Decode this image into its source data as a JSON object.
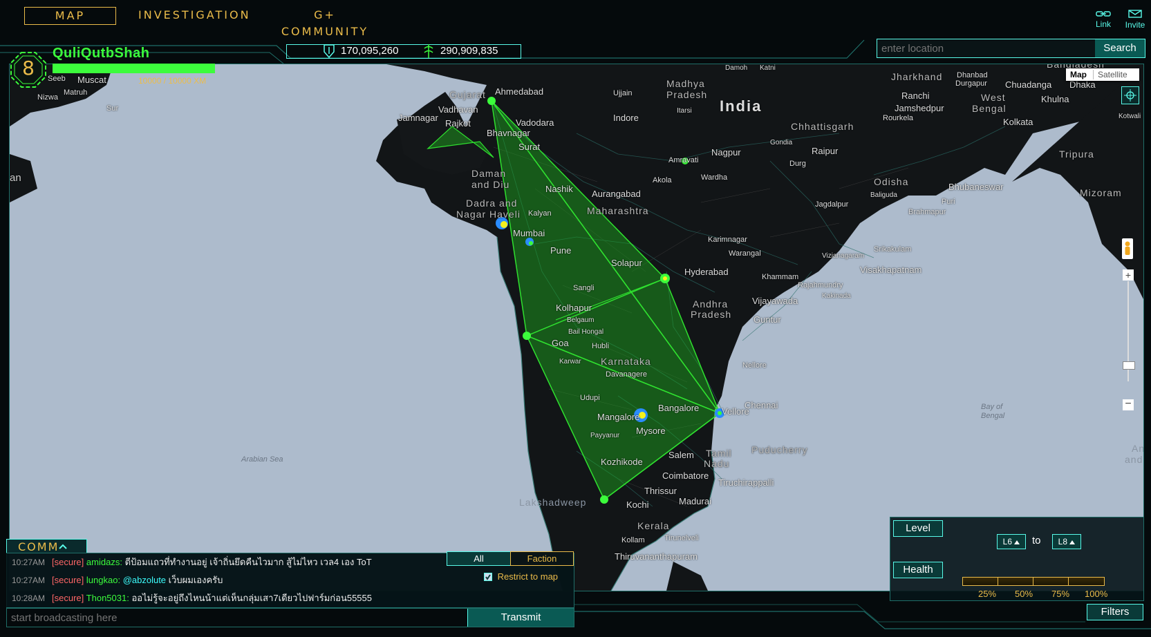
{
  "nav": {
    "tabs": [
      {
        "label": "MAP",
        "active": true
      },
      {
        "label": "INVESTIGATION",
        "active": false
      },
      {
        "label": "G+ COMMUNITY",
        "active": false
      }
    ],
    "link_label": "Link",
    "invite_label": "Invite"
  },
  "player": {
    "level": "8",
    "name": "QuliQutbShah",
    "xm": "10000 / 10000 XM",
    "xm_fraction": 1.0
  },
  "score": {
    "enlightened": "170,095,260",
    "resistance": "290,909,835"
  },
  "search": {
    "placeholder": "enter location",
    "button": "Search"
  },
  "map_controls": {
    "map": "Map",
    "satellite": "Satellite"
  },
  "labels": {
    "muscat": "Muscat",
    "seeb": "Seeb",
    "matruh": "Matruh",
    "nizwa": "Nizwa",
    "sur": "Sur",
    "iran": "an",
    "gujarat": "Gujarat",
    "ahmedabad": "Ahmedabad",
    "vadodara": "Vadodara",
    "vadhavan": "Vadhavan",
    "rajkot": "Rajkot",
    "jamnagar": "Jamnagar",
    "bhavnagar": "Bhavnagar",
    "surat": "Surat",
    "daman": "Daman",
    "and_diu": "and Diu",
    "dadra": "Dadra and",
    "nagar": "Nagar Haveli",
    "nashik": "Nashik",
    "aurangabad": "Aurangabad",
    "maharashtra": "Maharashtra",
    "kalyan": "Kalyan",
    "mumbai": "Mumbai",
    "pune": "Pune",
    "solapur": "Solapur",
    "sangli": "Sangli",
    "kolhapur": "Kolhapur",
    "belgaum": "Belgaum",
    "bail": "Bail Hongal",
    "hubli": "Hubli",
    "goa": "Goa",
    "karwar": "Karwar",
    "karnataka": "Karnataka",
    "davanagere": "Davanagere",
    "udupi": "Udupi",
    "mangalore": "Mangalore",
    "mysore": "Mysore",
    "bangalore": "Bangalore",
    "payyanur": "Payyanur",
    "kozhikode": "Kozhikode",
    "thrissur": "Thrissur",
    "kochi": "Kochi",
    "kerala": "Kerala",
    "kollam": "Kollam",
    "tvm": "Thiruvananthapuram",
    "madurai": "Madurai",
    "tirunelveli": "Tirunelveli",
    "salem": "Salem",
    "tamil": "Tamil",
    "nadu": "Nadu",
    "coimbatore": "Coimbatore",
    "tiruchirappalli": "Tiruchirappalli",
    "vellore": "Vellore",
    "chennai": "Chennai",
    "puducherry": "Puducherry",
    "nellore": "Nellore",
    "hyderabad": "Hyderabad",
    "andhra": "Andhra",
    "pradesh": "Pradesh",
    "guntur": "Guntur",
    "vijayawada": "Vijayawada",
    "khammam": "Khammam",
    "warangal": "Warangal",
    "karimnagar": "Karimnagar",
    "rajahmundry": "Rajahmundry",
    "kakinada": "Kakinada",
    "visakhapatnam": "Visakhapatnam",
    "srikakulam": "Srikakulam",
    "vizianagaram": "Vizianagaram",
    "india": "India",
    "madhya": "Madhya",
    "pradesh2": "Pradesh",
    "ujjain": "Ujjain",
    "indore": "Indore",
    "itarsi": "Itarsi",
    "damoh": "Damoh",
    "katni": "Katni",
    "nagpur": "Nagpur",
    "amravati": "Amravati",
    "wardha": "Wardha",
    "akola": "Akola",
    "gondia": "Gondia",
    "durg": "Durg",
    "raipur": "Raipur",
    "chhattisgarh": "Chhattisgarh",
    "jagdalpur": "Jagdalpur",
    "odisha": "Odisha",
    "baliguda": "Baliguda",
    "brahmapur": "Brahmapur",
    "bhubaneswar": "Bhubaneswar",
    "puri": "Puri",
    "rourkela": "Rourkela",
    "jharkhand": "Jharkhand",
    "dhanbad": "Dhanbad",
    "ranchi": "Ranchi",
    "durgapur": "Durgapur",
    "jamshedpur": "Jamshedpur",
    "west": "West",
    "bengal": "Bengal",
    "kolkata": "Kolkata",
    "chuadanga": "Chuadanga",
    "khulna": "Khulna",
    "dhaka": "Dhaka",
    "bangladesh": "Bangladesh",
    "tripura": "Tripura",
    "mizoram": "Mizoram",
    "kotwali": "Kotwali",
    "bay": "Bay of",
    "bay2": "Bengal",
    "arabian": "Arabian Sea",
    "lakshadweep": "Lakshadweep",
    "an2": "An",
    "and2": "and"
  },
  "comm": {
    "title": "COMM",
    "filter_all": "All",
    "filter_faction": "Faction",
    "restrict": "Restrict to map",
    "messages": [
      {
        "time": "10:27AM",
        "tag": "[secure]",
        "nick": "amidazs:",
        "mention": "",
        "text": "ตีป้อมแถวที่ทำงานอยู่ เจ้าถิ่นยึดคืนไวมาก สู้ไม่ไหว เวล4 เอง ToT"
      },
      {
        "time": "10:27AM",
        "tag": "[secure]",
        "nick": "lungkao:",
        "mention": "@abzolute",
        "text": "เว็บผมเองครับ"
      },
      {
        "time": "10:28AM",
        "tag": "[secure]",
        "nick": "Thon5031:",
        "mention": "",
        "text": "ออไม่รู้จะอยู่ถึงไหนน้าแต่เห็นกลุ่มเสา7เดียวไปฟาร์มก่อน55555"
      }
    ],
    "input_placeholder": "start broadcasting here",
    "transmit": "Transmit"
  },
  "filters": {
    "level_title": "Level",
    "level_from": "L6",
    "to": "to",
    "level_to": "L8",
    "health_title": "Health",
    "health_ticks": [
      "25%",
      "50%",
      "75%",
      "100%"
    ],
    "button": "Filters"
  },
  "colors": {
    "accent": "#59fbea",
    "gold": "#ebbc4a",
    "enl": "#3cfc3c",
    "land": "#121517",
    "water": "#adbbcc"
  }
}
